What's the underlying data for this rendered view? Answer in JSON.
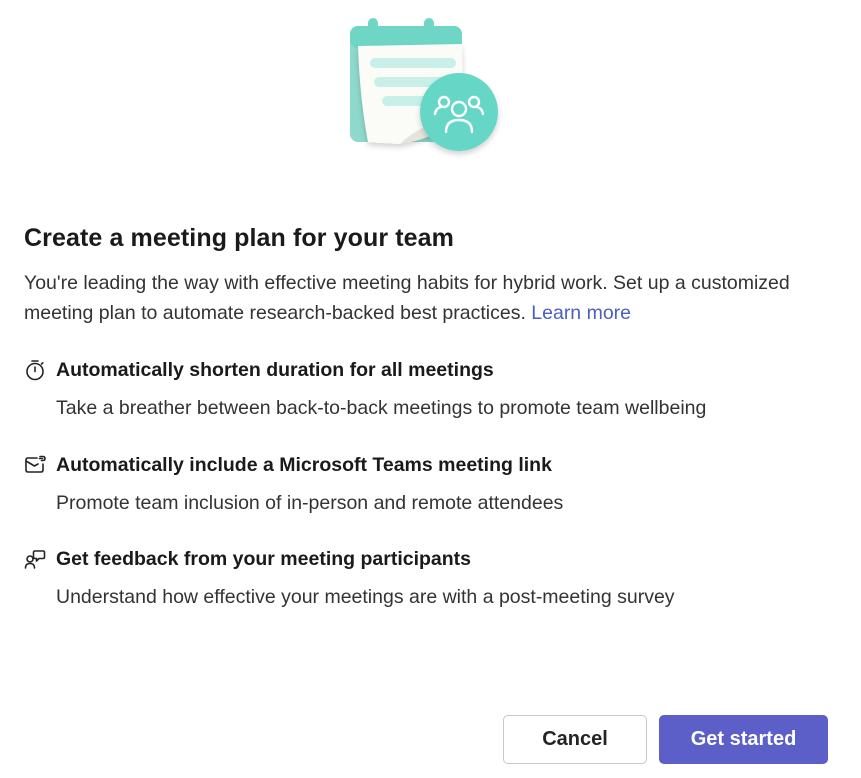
{
  "dialog": {
    "title": "Create a meeting plan for your team",
    "intro": "You're leading the way with effective meeting habits for hybrid work. Set up a customized meeting plan to automate research-backed best practices.",
    "learn_more": "Learn more"
  },
  "features": [
    {
      "icon": "timer-icon",
      "title": "Automatically shorten duration for all meetings",
      "description": "Take a breather between back-to-back meetings to promote team wellbeing"
    },
    {
      "icon": "meeting-link-icon",
      "title": "Automatically include a Microsoft Teams meeting link",
      "description": "Promote team inclusion of in-person and remote attendees"
    },
    {
      "icon": "feedback-icon",
      "title": "Get feedback from your meeting participants",
      "description": "Understand how effective your meetings are with a post-meeting survey"
    }
  ],
  "buttons": {
    "cancel": "Cancel",
    "primary": "Get started"
  },
  "colors": {
    "accent": "#5b5fc7",
    "link": "#4a5fc1",
    "illustration_teal": "#5fd6c4"
  }
}
